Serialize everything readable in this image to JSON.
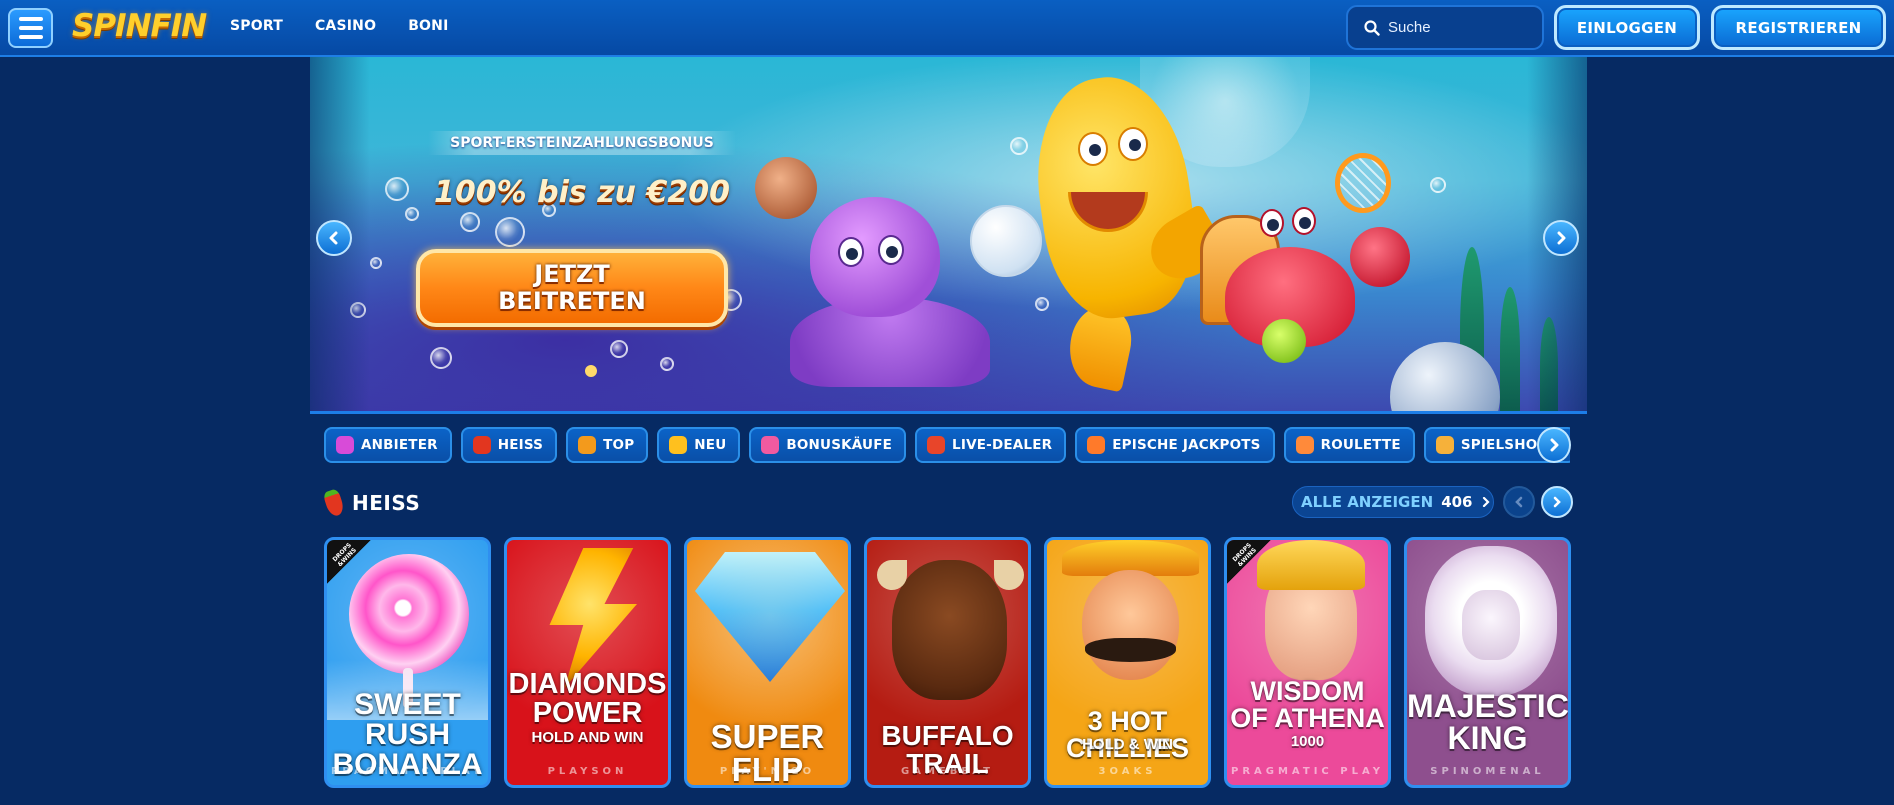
{
  "header": {
    "logo": "SPINFIN",
    "nav": [
      "SPORT",
      "CASINO",
      "BONI"
    ],
    "search_placeholder": "Suche",
    "login_label": "EINLOGGEN",
    "register_label": "REGISTRIEREN"
  },
  "hero": {
    "kicker": "SPORT-ERSTEINZAHLUNGSBONUS",
    "headline": "100% bis zu €200",
    "cta": "JETZT\nBEITRETEN"
  },
  "categories": [
    {
      "label": "ANBIETER",
      "icon": "provider-icon",
      "color": "#d84bd8"
    },
    {
      "label": "HEISS",
      "icon": "chili-icon",
      "color": "#e2361f"
    },
    {
      "label": "TOP",
      "icon": "crown-icon",
      "color": "#f39a1c"
    },
    {
      "label": "NEU",
      "icon": "lightning-icon",
      "color": "#ffc01e"
    },
    {
      "label": "BONUSKÄUFE",
      "icon": "gift-icon",
      "color": "#f05aa0"
    },
    {
      "label": "LIVE-DEALER",
      "icon": "chip-icon",
      "color": "#e8452a"
    },
    {
      "label": "EPISCHE JACKPOTS",
      "icon": "jackpot-icon",
      "color": "#ff7a2a"
    },
    {
      "label": "ROULETTE",
      "icon": "roulette-icon",
      "color": "#ff8a3a"
    },
    {
      "label": "SPIELSHOWS",
      "icon": "gameshow-icon",
      "color": "#f6b13a"
    }
  ],
  "section": {
    "title": "HEISS",
    "view_all_label": "ALLE ANZEIGEN",
    "view_all_count": "406"
  },
  "games": [
    {
      "title": "SWEET RUSH\nBONANZA",
      "provider": "PRAGMATIC PLAY",
      "badge": "DROPS\n&WINS",
      "bg": "#2e9ef0"
    },
    {
      "title": "DIAMONDS\nPOWER",
      "subtitle": "HOLD AND WIN",
      "provider": "PLAYSON",
      "bg": "#d8121a"
    },
    {
      "title": "SUPER FLIP",
      "provider": "PLAY'N GO",
      "bg": "#f08a10"
    },
    {
      "title": "BUFFALO TRAIL",
      "provider": "GAMEBEAT",
      "bg": "#b51c12"
    },
    {
      "title": "3 HOT CHILLIES",
      "subtitle": "HOLD & WIN",
      "provider": "3OAKS",
      "bg": "#f5a516"
    },
    {
      "title": "WISDOM\nOF ATHENA",
      "subtitle": "1000",
      "provider": "PRAGMATIC PLAY",
      "badge": "DROPS\n&WINS",
      "bg": "#ec4a9a"
    },
    {
      "title": "MAJESTIC\nKING",
      "provider": "SPINOMENAL",
      "bg": "#8e4f8e"
    }
  ]
}
